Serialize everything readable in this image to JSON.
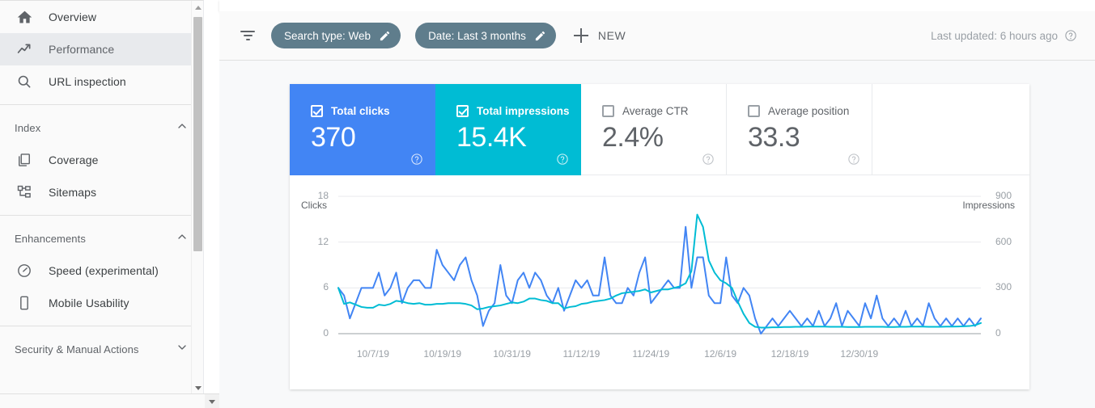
{
  "sidebar": {
    "items": [
      {
        "label": "Overview",
        "icon": "home-icon",
        "active": false
      },
      {
        "label": "Performance",
        "icon": "trending-up-icon",
        "active": true
      },
      {
        "label": "URL inspection",
        "icon": "search-icon",
        "active": false
      }
    ],
    "groups": [
      {
        "title": "Index",
        "expanded": true,
        "items": [
          {
            "label": "Coverage",
            "icon": "pages-icon"
          },
          {
            "label": "Sitemaps",
            "icon": "sitemap-icon"
          }
        ]
      },
      {
        "title": "Enhancements",
        "expanded": true,
        "items": [
          {
            "label": "Speed (experimental)",
            "icon": "speedometer-icon"
          },
          {
            "label": "Mobile Usability",
            "icon": "mobile-icon"
          }
        ]
      },
      {
        "title": "Security & Manual Actions",
        "expanded": false,
        "items": []
      }
    ]
  },
  "toolbar": {
    "filter_icon": "filter-icon",
    "chips": [
      {
        "label": "Search type: Web",
        "icon": "pencil-icon"
      },
      {
        "label": "Date: Last 3 months",
        "icon": "pencil-icon"
      }
    ],
    "new_label": "NEW",
    "new_icon": "plus-icon",
    "last_updated": "Last updated: 6 hours ago",
    "help_icon": "help-circle-icon"
  },
  "metrics": [
    {
      "title": "Total clicks",
      "value": "370",
      "checked": true,
      "color": "#4285f4",
      "style": "m-clicks"
    },
    {
      "title": "Total impressions",
      "value": "15.4K",
      "checked": true,
      "color": "#00bcd4",
      "style": "m-impr"
    },
    {
      "title": "Average CTR",
      "value": "2.4%",
      "checked": false,
      "color": "#ffffff",
      "style": "m-ctr"
    },
    {
      "title": "Average position",
      "value": "33.3",
      "checked": false,
      "color": "#ffffff",
      "style": "m-pos"
    }
  ],
  "chart_data": {
    "type": "line",
    "title": "",
    "xlabel": "",
    "ylabel": "Clicks",
    "y2label": "Impressions",
    "ylim": [
      0,
      18
    ],
    "y2lim": [
      0,
      900
    ],
    "yticks": [
      "0",
      "6",
      "12",
      "18"
    ],
    "y2ticks": [
      "0",
      "300",
      "600",
      "900"
    ],
    "grid": true,
    "legend": "none",
    "xticks": [
      "10/7/19",
      "10/19/19",
      "10/31/19",
      "11/12/19",
      "11/24/19",
      "12/6/19",
      "12/18/19",
      "12/30/19"
    ],
    "x_start": "10/1/19",
    "x_end": "1/1/20",
    "n_points": 93,
    "series": [
      {
        "name": "Clicks",
        "color": "#4285f4",
        "axis": "left",
        "values": [
          6,
          5,
          2,
          4,
          6,
          6,
          6,
          8,
          5,
          6,
          8,
          4,
          6,
          7,
          7,
          6,
          6,
          11,
          9,
          8,
          7,
          9,
          10,
          7,
          5,
          1,
          3,
          4,
          9,
          5,
          4,
          7,
          8,
          6,
          8,
          7,
          5,
          4,
          6,
          3,
          5,
          7,
          6,
          7,
          5,
          5,
          10,
          5,
          4,
          4,
          6,
          5,
          8,
          10,
          4,
          5,
          6,
          7,
          6,
          6,
          14,
          6,
          10,
          10,
          5,
          4,
          4,
          10,
          5,
          4,
          6,
          5,
          2,
          0,
          1,
          2,
          1,
          2,
          3,
          2,
          1,
          2,
          1,
          3,
          1,
          2,
          4,
          1,
          3,
          2,
          1,
          4,
          2,
          5,
          2,
          1,
          2,
          1,
          3,
          1,
          2,
          1,
          4,
          2,
          1,
          2,
          1,
          2,
          1,
          2,
          1,
          2
        ]
      },
      {
        "name": "Impressions",
        "color": "#00bcd4",
        "axis": "right",
        "values": [
          300,
          195,
          205,
          190,
          175,
          170,
          170,
          190,
          185,
          195,
          215,
          210,
          200,
          195,
          200,
          190,
          190,
          195,
          195,
          200,
          200,
          200,
          195,
          185,
          160,
          165,
          175,
          180,
          185,
          195,
          205,
          200,
          210,
          230,
          230,
          220,
          215,
          200,
          200,
          165,
          175,
          180,
          195,
          200,
          210,
          215,
          220,
          230,
          250,
          265,
          270,
          275,
          280,
          290,
          270,
          280,
          290,
          290,
          300,
          310,
          330,
          410,
          780,
          700,
          480,
          400,
          350,
          330,
          300,
          210,
          130,
          70,
          45,
          40,
          40,
          42,
          42,
          44,
          44,
          45,
          45,
          46,
          46,
          46,
          46,
          45,
          45,
          45,
          44,
          44,
          44,
          45,
          45,
          45,
          45,
          44,
          44,
          45,
          45,
          46,
          46,
          46,
          45,
          45,
          45,
          46,
          46,
          47,
          48,
          50,
          55,
          70
        ]
      }
    ]
  }
}
